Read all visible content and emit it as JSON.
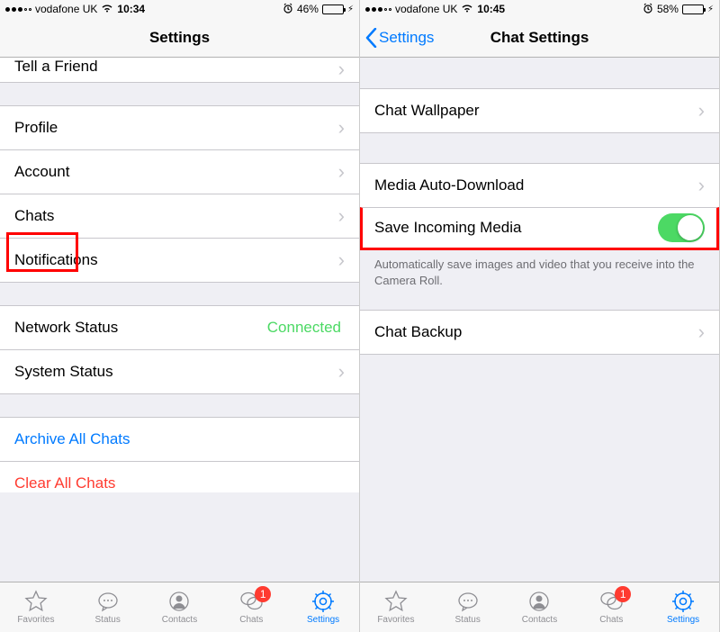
{
  "left": {
    "status": {
      "carrier": "vodafone UK",
      "time": "10:34",
      "battery_pct": "46%",
      "battery_fill": 46
    },
    "nav": {
      "title": "Settings"
    },
    "rows": {
      "tell_friend": "Tell a Friend",
      "profile": "Profile",
      "account": "Account",
      "chats": "Chats",
      "notifications": "Notifications",
      "network_status": "Network Status",
      "network_value": "Connected",
      "system_status": "System Status",
      "archive": "Archive All Chats",
      "clear": "Clear All Chats"
    }
  },
  "right": {
    "status": {
      "carrier": "vodafone UK",
      "time": "10:45",
      "battery_pct": "58%",
      "battery_fill": 58
    },
    "nav": {
      "back": "Settings",
      "title": "Chat Settings"
    },
    "rows": {
      "wallpaper": "Chat Wallpaper",
      "media_auto": "Media Auto-Download",
      "save_incoming": "Save Incoming Media",
      "save_note": "Automatically save images and video that you receive into the Camera Roll.",
      "chat_backup": "Chat Backup"
    }
  },
  "tabs": {
    "favorites": "Favorites",
    "status": "Status",
    "contacts": "Contacts",
    "chats": "Chats",
    "settings": "Settings",
    "chats_badge": "1"
  }
}
